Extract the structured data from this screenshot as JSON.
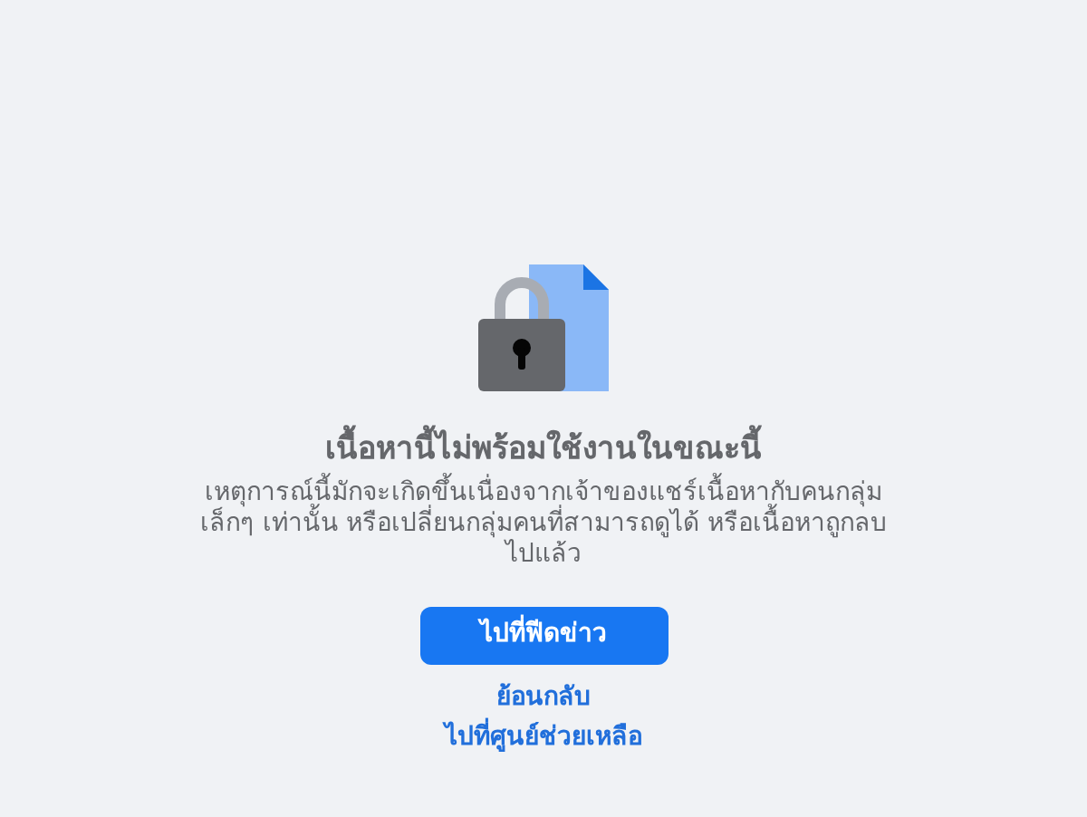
{
  "title": "เนื้อหานี้ไม่พร้อมใช้งานในขณะนี้",
  "description": "เหตุการณ์นี้มักจะเกิดขึ้นเนื่องจากเจ้าของแชร์เนื้อหากับคนกลุ่มเล็กๆ เท่านั้น หรือเปลี่ยนกลุ่มคนที่สามารถดูได้ หรือเนื้อหาถูกลบไปแล้ว",
  "primary_button": "ไปที่ฟีดข่าว",
  "links": [
    "ย้อนกลับ",
    "ไปที่ศูนย์ช่วยเหลือ"
  ]
}
